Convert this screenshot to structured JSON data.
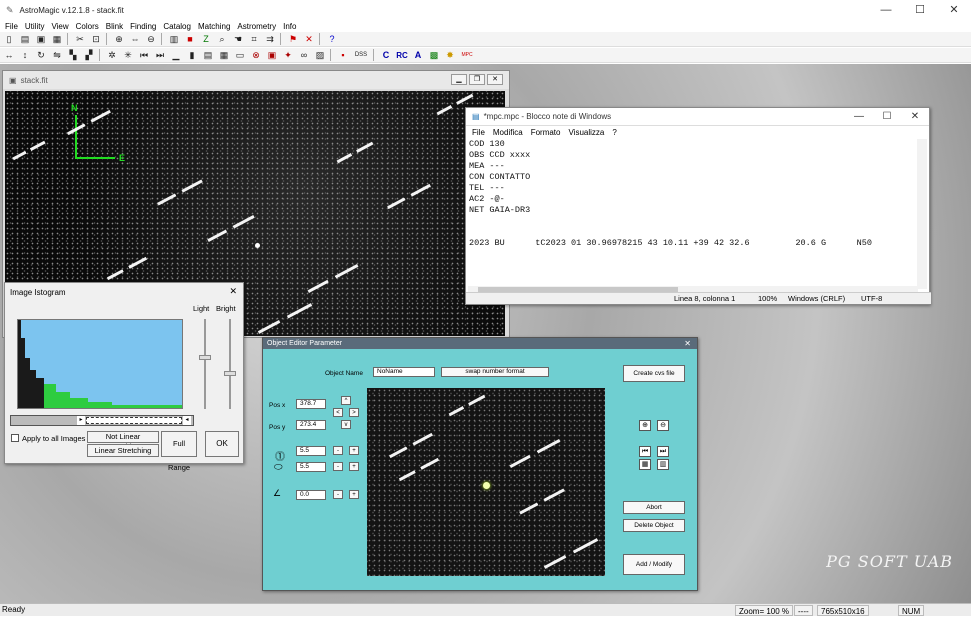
{
  "app": {
    "title": "AstroMagic  v.12.1.8  -  stack.fit"
  },
  "menu": [
    "File",
    "Utility",
    "View",
    "Colors",
    "Blink",
    "Finding",
    "Catalog",
    "Matching",
    "Astrometry",
    "Info"
  ],
  "toolbar": {
    "dss_label": "DSS",
    "c_label": "C",
    "rc_label": "RC",
    "a_label": "A",
    "mpc_label": "MPC"
  },
  "image_window": {
    "title": "stack.fit",
    "north_label": "N",
    "east_label": "E"
  },
  "notepad": {
    "title": "*mpc.mpc - Blocco note di Windows",
    "menu": [
      "File",
      "Modifica",
      "Formato",
      "Visualizza",
      "?"
    ],
    "lines": [
      "COD 130",
      "OBS CCD xxxx",
      "MEA ---",
      "CON CONTATTO",
      "TEL ---",
      "AC2 -@-",
      "NET GAIA-DR3",
      "",
      "",
      "2023 BU      tC2023 01 30.96978215 43 10.11 +39 42 32.6         20.6 G      N50"
    ],
    "status": {
      "position": "Linea 8, colonna 1",
      "zoom": "100%",
      "eol": "Windows (CRLF)",
      "encoding": "UTF-8"
    }
  },
  "histogram": {
    "title": "Image Istogram",
    "light_label": "Light",
    "bright_label": "Bright",
    "apply_all_label": "Apply to all Images",
    "not_linear_label": "Not Linear Stretching",
    "linear_label": "Linear Stretching",
    "full_range_label": "Full Range",
    "ok_label": "OK"
  },
  "object_editor": {
    "title": "Object Editor Parameter",
    "object_name_label": "Object Name",
    "object_name_value": "NoName",
    "swap_label": "swap number format",
    "create_csv_label": "Create  cvs file",
    "pos_x_label": "Pos x",
    "pos_y_label": "Pos y",
    "pos_x_value": "378.7",
    "pos_y_value": "273.4",
    "size1_value": "5.5",
    "size2_value": "5.5",
    "angle_value": "0.0",
    "abort_label": "Abort",
    "delete_label": "Delete Object",
    "add_modify_label": "Add / Modify"
  },
  "status": {
    "ready": "Ready",
    "zoom": "Zoom= 100 %",
    "dashes": "----",
    "dimensions": "765x510x16",
    "num": "NUM"
  },
  "brand": "PG  SOFT UAB"
}
